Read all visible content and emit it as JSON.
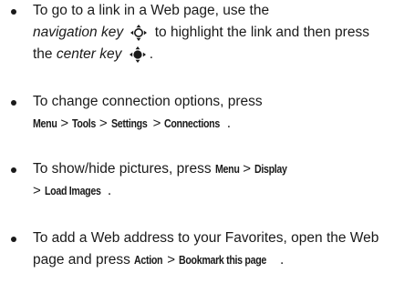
{
  "tips": [
    {
      "lead": "To go to a link in a Web page, use the",
      "nav_key": "navigation key",
      "middle": "to highlight the link and then press the",
      "center_key": "center key",
      "end": "."
    },
    {
      "lead": "To change connection options, press",
      "path": [
        "Menu",
        "Tools",
        "Settings",
        "Connections"
      ],
      "end": "."
    },
    {
      "lead": "To show/hide pictures, press",
      "path": [
        "Menu",
        "Display",
        "Load Images"
      ],
      "end": "."
    },
    {
      "lead": "To add a Web address to your Favorites, open the Web page and press",
      "path": [
        "Action",
        "Bookmark this page"
      ],
      "end": "."
    }
  ],
  "separator": ">",
  "icons": {
    "nav_key": "navigation-key-icon",
    "center_key": "center-key-icon"
  }
}
